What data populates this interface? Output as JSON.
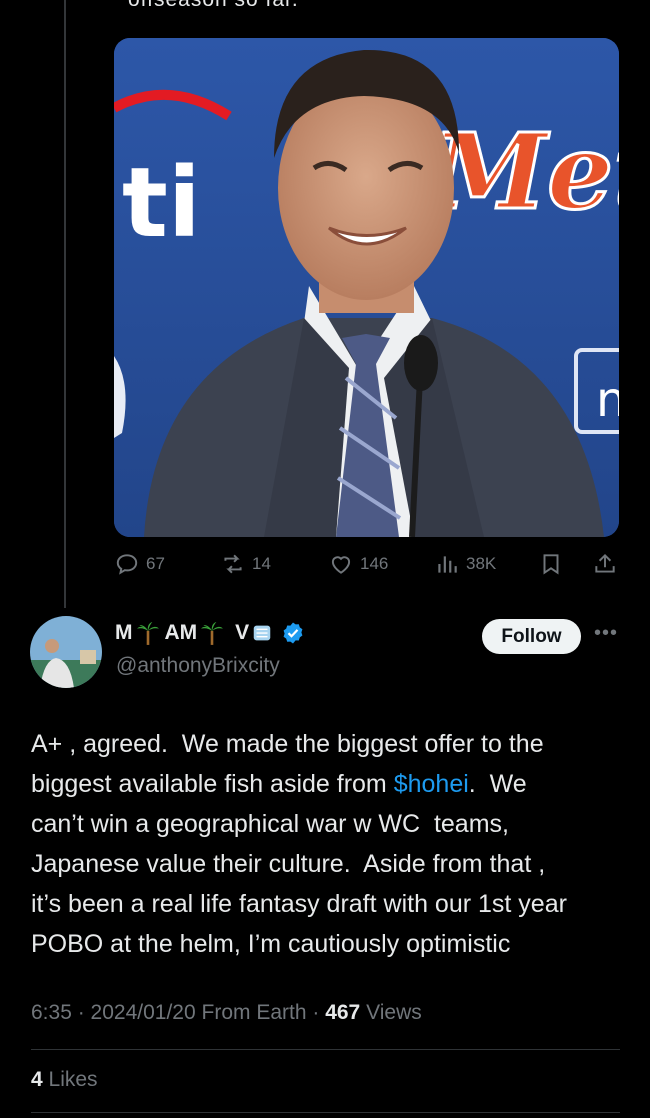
{
  "previous_tweet": {
    "truncated_text": "offseason so far.",
    "media": {
      "alt": "Man in suit smiling at a press conference in front of a Mets backdrop",
      "backdrop_text_left": "ti",
      "backdrop_text_right": "Mets",
      "backdrop_text_edge": "n"
    },
    "actions": {
      "replies": "67",
      "reposts": "14",
      "likes": "146",
      "views": "38K"
    }
  },
  "reply": {
    "author": {
      "name_parts": [
        "M",
        "AM",
        "V"
      ],
      "handle": "@anthonyBrixcity",
      "verified": true
    },
    "follow_label": "Follow",
    "more_label": "•••",
    "text_lines": [
      "A+ , agreed.  We made the biggest offer to the",
      "biggest available fish aside from ",
      "can’t win a geographical war w WC  teams,",
      "Japanese value their culture.  Aside from that ,",
      "it’s been a real life fantasy draft with our 1st year",
      "POBO at the helm, I’m cautiously optimistic"
    ],
    "cashtag": "$hohei",
    "after_cashtag": ".  We",
    "time": "6:35",
    "date": "2024/01/20",
    "source": "From Earth",
    "views_count": "467",
    "views_label": "Views",
    "likes_count": "4",
    "likes_label": "Likes"
  },
  "colors": {
    "background": "#000000",
    "text": "#e7e9ea",
    "muted": "#71767b",
    "link": "#1d9bf0",
    "verified": "#1d9bf0"
  },
  "icons": [
    "reply-icon",
    "repost-icon",
    "like-icon",
    "views-icon",
    "bookmark-icon",
    "share-icon",
    "verified-badge-icon",
    "palm-tree-icon",
    "ice-cube-icon"
  ]
}
